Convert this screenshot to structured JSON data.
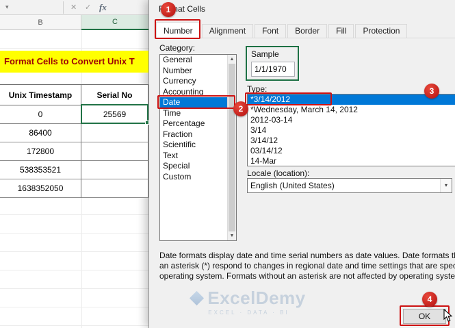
{
  "steps": [
    "1",
    "2",
    "3",
    "4"
  ],
  "colors": {
    "annotation_red": "#cc1111",
    "annotation_green": "#1e7145",
    "selection_blue": "#0078d7",
    "excel_green": "#217346",
    "banner_yellow": "#ffff00",
    "banner_text": "#9c0006"
  },
  "icons": {
    "name_box_dropdown": "▾",
    "cancel": "✕",
    "enter": "✓",
    "insert_function": "fx",
    "combo_arrow": "▾",
    "scroll_up": "▲",
    "scroll_down": "▼"
  },
  "excel": {
    "column_headers": [
      "B",
      "C"
    ],
    "banner_title": "Format Cells to Convert Unix T",
    "table": {
      "headers": [
        "Unix Timestamp",
        "Serial No"
      ],
      "rows": [
        {
          "unix": "0",
          "serial": "25569"
        },
        {
          "unix": "86400",
          "serial": ""
        },
        {
          "unix": "172800",
          "serial": ""
        },
        {
          "unix": "538353521",
          "serial": ""
        },
        {
          "unix": "1638352050",
          "serial": ""
        }
      ]
    }
  },
  "dialog": {
    "title": "Format Cells",
    "tabs": [
      {
        "label": "Number"
      },
      {
        "label": "Alignment"
      },
      {
        "label": "Font"
      },
      {
        "label": "Border"
      },
      {
        "label": "Fill"
      },
      {
        "label": "Protection"
      }
    ],
    "category_label": "Category:",
    "categories": [
      "General",
      "Number",
      "Currency",
      "Accounting",
      "Date",
      "Time",
      "Percentage",
      "Fraction",
      "Scientific",
      "Text",
      "Special",
      "Custom"
    ],
    "selected_category": "Date",
    "sample_label": "Sample",
    "sample_value": "1/1/1970",
    "type_label": "Type:",
    "types": [
      "*3/14/2012",
      "*Wednesday, March 14, 2012",
      "2012-03-14",
      "3/14",
      "3/14/12",
      "03/14/12",
      "14-Mar"
    ],
    "selected_type": "*3/14/2012",
    "locale_label": "Locale (location):",
    "locale_value": "English (United States)",
    "description_lines": [
      "Date formats display date and time serial numbers as date values.  Date formats that begin with",
      "an asterisk (*) respond to changes in regional date and time settings that are specified for the",
      "operating system. Formats without an asterisk are not affected by operating system settings."
    ],
    "ok_label": "OK"
  },
  "watermark": {
    "brand": "ExcelDemy",
    "tagline": "EXCEL · DATA · BI"
  }
}
